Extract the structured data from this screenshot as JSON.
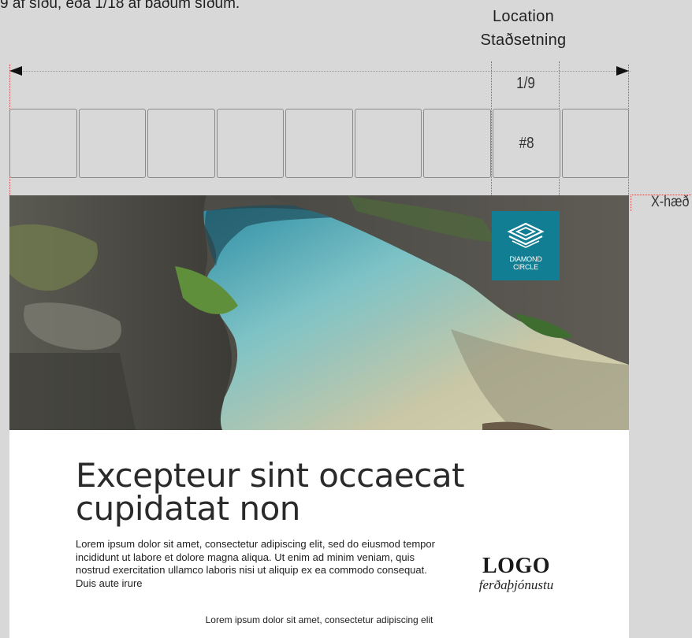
{
  "top_note": "9 af síðu, eða 1/18 af báðum síðum.",
  "location": {
    "line1": "Location",
    "line2": "Staðsetning"
  },
  "fraction_label": "1/9",
  "grid": {
    "cells": [
      "",
      "",
      "",
      "",
      "",
      "",
      "",
      "#8",
      ""
    ]
  },
  "x_height_label": "X-hæð",
  "badge": {
    "line1": "DIAMOND",
    "line2": "CIRCLE",
    "color": "#127e93"
  },
  "headline": "Excepteur sint occaecat cupidatat non",
  "body": "Lorem ipsum dolor sit amet, consectetur adipiscing elit, sed do eiusmod tempor incididunt ut labore et dolore magna aliqua. Ut enim ad minim veniam, quis nostrud exercitation ullamco laboris nisi ut aliquip ex ea commodo consequat. Duis aute irure",
  "logo": {
    "title": "LOGO",
    "subtitle": "ferðaþjónustu"
  },
  "footer": "Lorem ipsum dolor sit amet, consectetur adipiscing elit"
}
